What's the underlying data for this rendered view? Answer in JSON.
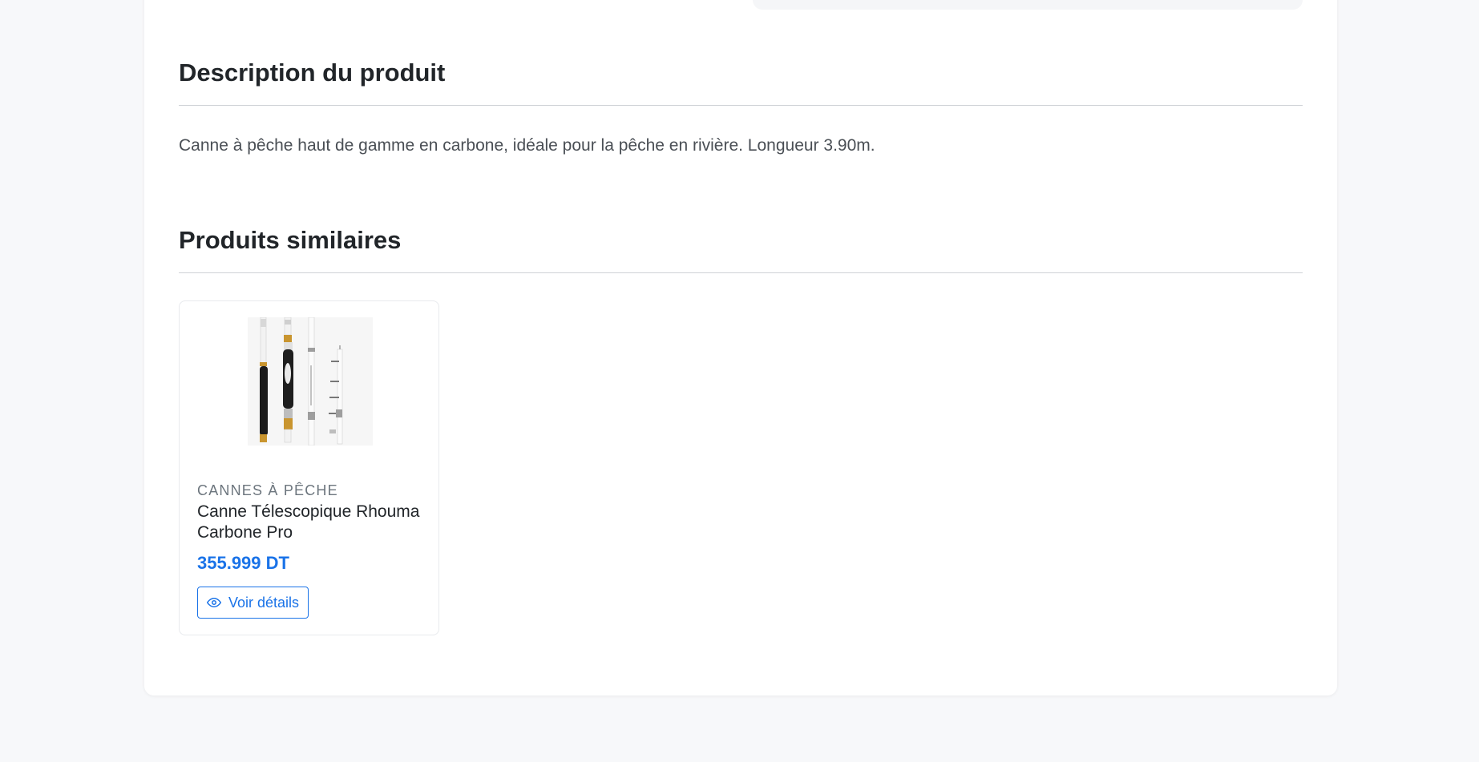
{
  "description": {
    "title": "Description du produit",
    "text": "Canne à pêche haut de gamme en carbone, idéale pour la pêche en rivière. Longueur 3.90m."
  },
  "similar_products": {
    "title": "Produits similaires",
    "items": [
      {
        "category": "Cannes à pêche",
        "name": "Canne Télescopique Rhouma Carbone Pro",
        "price": "355.999 DT",
        "button_label": "Voir détails",
        "button_icon": "eye-icon",
        "image": "telescopic-fishing-rod-photo"
      }
    ]
  },
  "colors": {
    "accent": "#1a73e8",
    "background": "#f7f8fa",
    "heading": "#212529",
    "muted": "#6c757d"
  }
}
